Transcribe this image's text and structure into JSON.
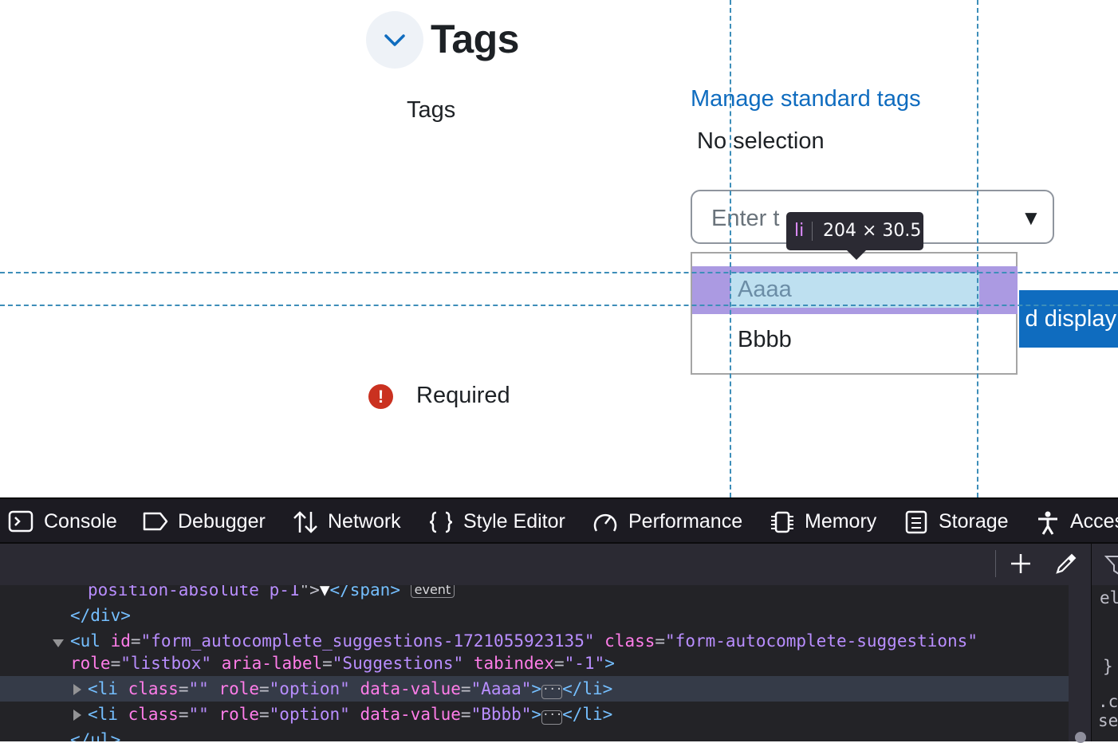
{
  "page": {
    "section_title": "Tags",
    "field_label": "Tags",
    "manage_link": "Manage standard tags",
    "no_selection": "No selection",
    "input_placeholder": "Enter t",
    "dropdown_arrow": "▼",
    "suggestions": [
      "Aaaa",
      "Bbbb"
    ],
    "submit_button": "d display",
    "required": "Required",
    "required_icon": "!"
  },
  "inspector_tooltip": {
    "tag": "li",
    "dims": "204 × 30.5"
  },
  "devtools": {
    "tabs": [
      "Console",
      "Debugger",
      "Network",
      "Style Editor",
      "Performance",
      "Memory",
      "Storage",
      "Acces"
    ],
    "markup": {
      "line0": {
        "attr_tail": "position-absolute p-1",
        "close_q": "\">",
        "text": "▼",
        "close_tag": "</span>",
        "badge": "event"
      },
      "line1": {
        "close_tag": "</div>"
      },
      "line2": {
        "open": "<ul",
        "id_name": "id",
        "id_value": "\"form_autocomplete_suggestions-1721055923135\"",
        "class_name": "class",
        "class_value": "\"form-autocomplete-suggestions\""
      },
      "line3": {
        "role_name": "role",
        "role_value": "\"listbox\"",
        "aria_name": "aria-label",
        "aria_value": "\"Suggestions\"",
        "tab_name": "tabindex",
        "tab_value": "\"-1\"",
        "end": "\">"
      },
      "line4": {
        "open": "<li",
        "class_name": "class",
        "class_value": "\"\"",
        "role_name": "role",
        "role_value": "\"option\"",
        "dv_name": "data-value",
        "dv_value": "\"Aaaa\"",
        "close": "</li>"
      },
      "line5": {
        "open": "<li",
        "class_name": "class",
        "class_value": "\"\"",
        "role_name": "role",
        "role_value": "\"option\"",
        "dv_name": "data-value",
        "dv_value": "\"Bbbb\"",
        "close": "</li>"
      },
      "line6": {
        "close_tag": "</ul>"
      }
    },
    "side_panel": [
      "el",
      "}",
      ".c",
      "se"
    ]
  },
  "colors": {
    "link": "#0f6cbf",
    "button": "#0f6cbf",
    "required_icon": "#ca3120",
    "highlight_margin": "#ab9ae2",
    "highlight_content": "#bee0f0",
    "devtools_bg": "#232327"
  }
}
